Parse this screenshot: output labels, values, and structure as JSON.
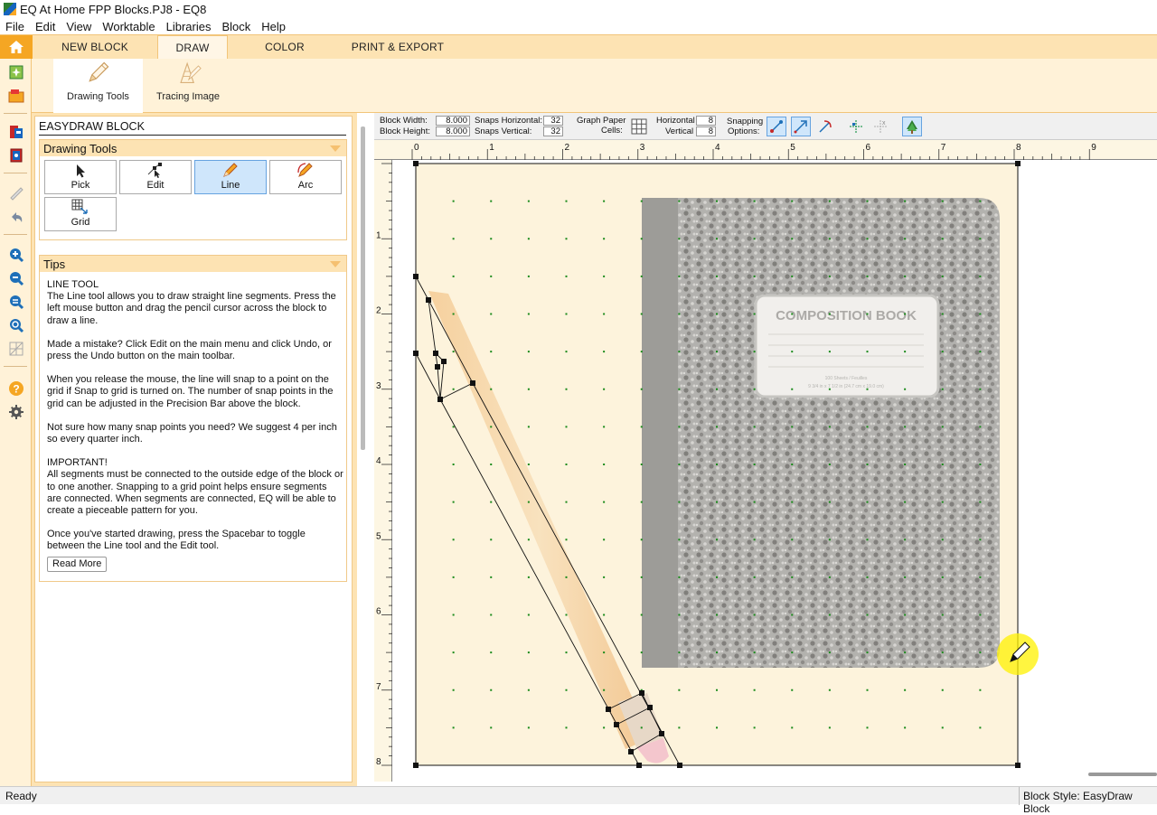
{
  "window": {
    "title": "EQ At Home FPP Blocks.PJ8 - EQ8"
  },
  "menu": [
    "File",
    "Edit",
    "View",
    "Worktable",
    "Libraries",
    "Block",
    "Help"
  ],
  "ribbon_tabs": [
    {
      "label": "NEW BLOCK"
    },
    {
      "label": "DRAW"
    },
    {
      "label": "COLOR"
    },
    {
      "label": "PRINT & EXPORT"
    }
  ],
  "ribbon_buttons": {
    "drawing_tools": "Drawing Tools",
    "tracing_image": "Tracing Image"
  },
  "panel": {
    "title": "EASYDRAW BLOCK",
    "tools_header": "Drawing Tools",
    "tools": [
      "Pick",
      "Edit",
      "Line",
      "Arc",
      "Grid"
    ],
    "tips_header": "Tips",
    "tips": [
      "LINE TOOL\nThe Line tool allows you to draw straight line segments. Press the left mouse button and drag the pencil cursor across the block to draw a line.",
      "Made a mistake? Click Edit on the main menu and click Undo, or press the Undo button on the main toolbar.",
      "When you release the mouse, the line will snap to a point on the grid if Snap to grid is turned on. The number of snap points in the grid can be adjusted in the Precision Bar above the block.",
      "Not sure how many snap points you need? We suggest 4 per inch so every quarter inch.",
      "IMPORTANT!\nAll segments must be connected to the outside edge of the block or to one another. Snapping to a grid point helps ensure segments are connected. When segments are connected, EQ will be able to create a pieceable pattern for you.",
      "Once you've started drawing, press the Spacebar to toggle between the Line tool and the Edit tool."
    ],
    "read_more": "Read More"
  },
  "precision_bar": {
    "block_width_label": "Block Width:",
    "block_width": "8.000",
    "block_height_label": "Block Height:",
    "block_height": "8.000",
    "snaps_h_label": "Snaps Horizontal:",
    "snaps_h": "32",
    "snaps_v_label": "Snaps Vertical:",
    "snaps_v": "32",
    "graph_label_1": "Graph Paper",
    "graph_label_2": "Cells:",
    "horizontal_label": "Horizontal",
    "horizontal": "8",
    "vertical_label": "Vertical",
    "vertical": "8",
    "snapping_label_1": "Snapping",
    "snapping_label_2": "Options:"
  },
  "ruler": {
    "ticks": [
      "0",
      "1",
      "2",
      "3",
      "4",
      "5",
      "6",
      "7",
      "8",
      "9"
    ],
    "vticks": [
      "1",
      "2",
      "3",
      "4",
      "5",
      "6",
      "7",
      "8"
    ]
  },
  "tracing_image": {
    "cover_text": "COMPOSITION BOOK",
    "cover_sub_1": "100 Sheets / Feuilles",
    "cover_sub_2": "9 3/4 in x 7 1/2 in (24.7 cm x 19.0 cm)"
  },
  "status": {
    "left": "Ready",
    "right": "Block Style: EasyDraw Block"
  },
  "colors": {
    "accent": "#f5a623",
    "ribbon": "#fde3b3",
    "selected": "#cfe6fb",
    "grid_dot": "#1a8a1a"
  }
}
